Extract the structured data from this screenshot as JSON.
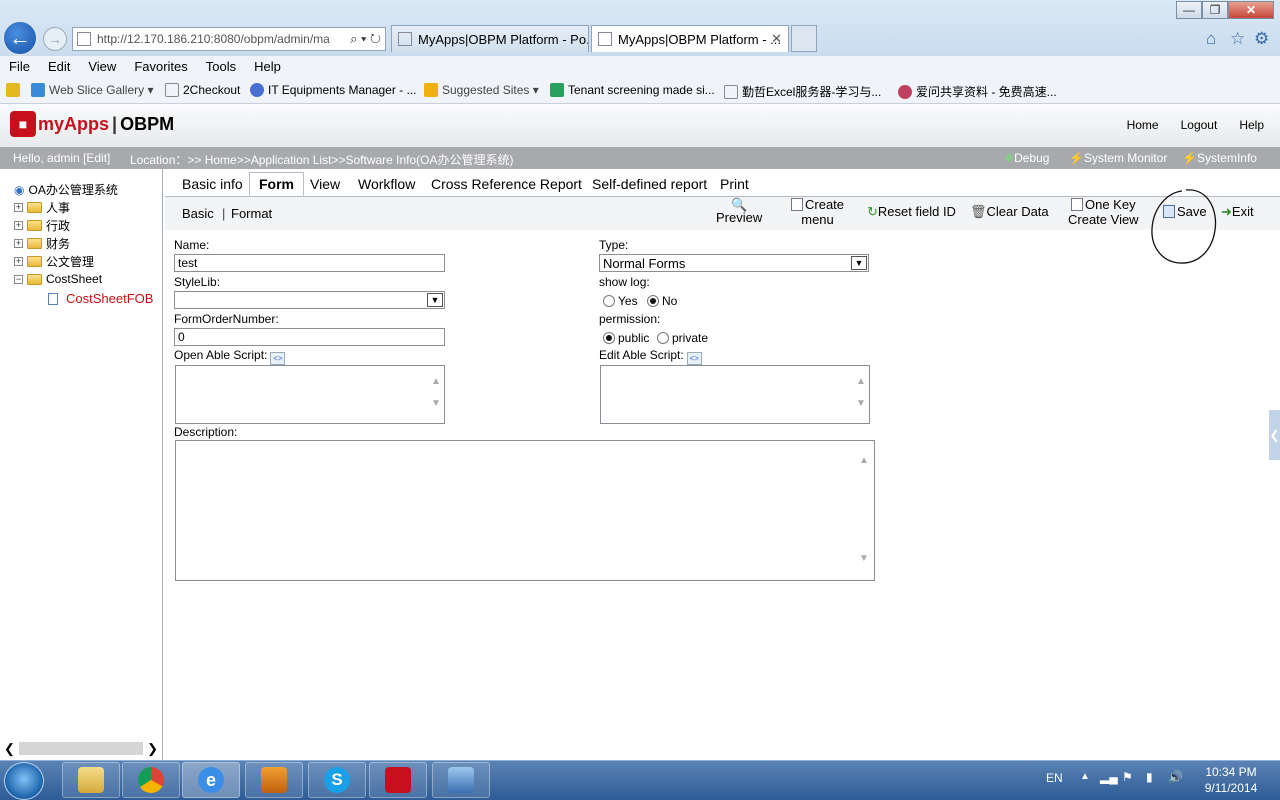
{
  "browser": {
    "address": "http://12.170.186.210:8080/obpm/admin/ma",
    "tabs": [
      {
        "title": "MyApps|OBPM Platform - Po..."
      },
      {
        "title": "MyApps|OBPM Platform - ..."
      }
    ],
    "menu": [
      "File",
      "Edit",
      "View",
      "Favorites",
      "Tools",
      "Help"
    ],
    "favorites": [
      {
        "label": "Web Slice Gallery",
        "has_dropdown": true
      },
      {
        "label": "2Checkout"
      },
      {
        "label": "IT Equipments Manager - ..."
      },
      {
        "label": "Suggested Sites",
        "has_dropdown": true
      },
      {
        "label": "Tenant screening made si..."
      },
      {
        "label": "勤哲Excel服务器-学习与..."
      },
      {
        "label": "爱问共享资料 - 免费高速..."
      }
    ]
  },
  "app": {
    "logo": {
      "my": "myApps",
      "sep": "|",
      "obpm": "OBPM"
    },
    "top_links": [
      "Home",
      "Logout",
      "Help"
    ],
    "status": {
      "greeting": "Hello, admin [Edit]",
      "location": "Location：>> Home>>Application List>>Software Info(OA办公管理系统)",
      "debug": "Debug",
      "system_monitor": "System Monitor",
      "system_info": "SystemInfo"
    },
    "tree": {
      "root": "OA办公管理系统",
      "folders": [
        "人事",
        "行政",
        "财务",
        "公文管理",
        "CostSheet"
      ],
      "selected_leaf": "CostSheetFOB"
    },
    "tabs": [
      "Basic info",
      "Form",
      "View",
      "Workflow",
      "Cross Reference Report",
      "Self-defined report",
      "Print"
    ],
    "active_tab": "Form",
    "subtabs": [
      "Basic",
      "Format"
    ],
    "subtab_sep": "|",
    "toolbar": {
      "preview": "Preview",
      "create_menu_1": "Create",
      "create_menu_2": "menu",
      "reset_field_id": "Reset field ID",
      "clear_data": "Clear Data",
      "one_key_1": "One Key",
      "one_key_2": "Create View",
      "save": "Save",
      "exit": "Exit"
    },
    "form": {
      "name_label": "Name:",
      "name_value": "test",
      "stylelib_label": "StyleLib:",
      "stylelib_value": "",
      "order_label": "FormOrderNumber:",
      "order_value": "0",
      "open_script_label": "Open Able Script:",
      "type_label": "Type:",
      "type_value": "Normal Forms",
      "showlog_label": "show log:",
      "showlog_yes": "Yes",
      "showlog_no": "No",
      "showlog_selected": "No",
      "permission_label": "permission:",
      "perm_public": "public",
      "perm_private": "private",
      "perm_selected": "public",
      "edit_script_label": "Edit Able Script:",
      "description_label": "Description:"
    }
  },
  "taskbar": {
    "lang": "EN",
    "time": "10:34 PM",
    "date": "9/11/2014"
  }
}
